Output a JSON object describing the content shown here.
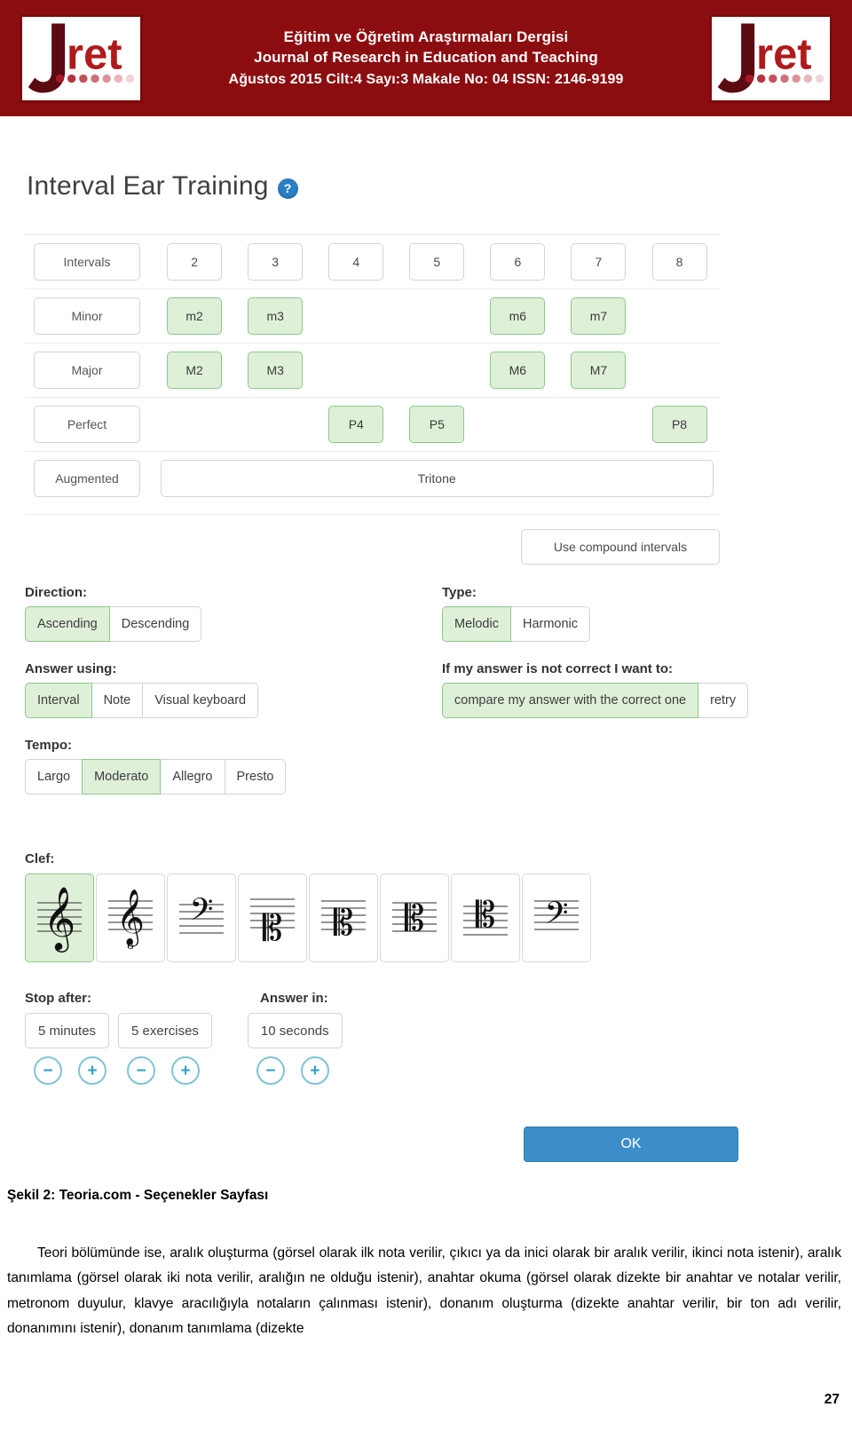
{
  "header": {
    "journal_title_tr": "Eğitim ve Öğretim Araştırmaları Dergisi",
    "journal_title_en": "Journal of Research in Education and Teaching",
    "issue_line": "Ağustos 2015  Cilt:4  Sayı:3  Makale No: 04   ISSN: 2146-9199",
    "logo_text": "ret",
    "logo_letter": "J",
    "banner_color": "#8c0d10"
  },
  "app": {
    "title": "Interval Ear Training",
    "help_icon_label": "?",
    "accent_selected_bg": "#dff0d8",
    "accent_selected_border": "#8cc88c",
    "ok_button_color": "#3d8dc9",
    "intervals_table": {
      "header_label": "Intervals",
      "columns": [
        "2",
        "3",
        "4",
        "5",
        "6",
        "7",
        "8"
      ],
      "rows": [
        {
          "label": "Minor",
          "cells": [
            {
              "text": "m2",
              "selected": true
            },
            {
              "text": "m3",
              "selected": true
            },
            {
              "text": "",
              "selected": false
            },
            {
              "text": "",
              "selected": false
            },
            {
              "text": "m6",
              "selected": true
            },
            {
              "text": "m7",
              "selected": true
            },
            {
              "text": "",
              "selected": false
            }
          ]
        },
        {
          "label": "Major",
          "cells": [
            {
              "text": "M2",
              "selected": true
            },
            {
              "text": "M3",
              "selected": true
            },
            {
              "text": "",
              "selected": false
            },
            {
              "text": "",
              "selected": false
            },
            {
              "text": "M6",
              "selected": true
            },
            {
              "text": "M7",
              "selected": true
            },
            {
              "text": "",
              "selected": false
            }
          ]
        },
        {
          "label": "Perfect",
          "cells": [
            {
              "text": "",
              "selected": false
            },
            {
              "text": "",
              "selected": false
            },
            {
              "text": "P4",
              "selected": true
            },
            {
              "text": "P5",
              "selected": true
            },
            {
              "text": "",
              "selected": false
            },
            {
              "text": "",
              "selected": false
            },
            {
              "text": "P8",
              "selected": true
            }
          ]
        }
      ],
      "augmented_label": "Augmented",
      "tritone_label": "Tritone",
      "tritone_selected": false
    },
    "compound_button": "Use compound intervals",
    "direction": {
      "label": "Direction:",
      "options": [
        {
          "text": "Ascending",
          "selected": true
        },
        {
          "text": "Descending",
          "selected": false
        }
      ]
    },
    "type": {
      "label": "Type:",
      "options": [
        {
          "text": "Melodic",
          "selected": true
        },
        {
          "text": "Harmonic",
          "selected": false
        }
      ]
    },
    "answer_using": {
      "label": "Answer using:",
      "options": [
        {
          "text": "Interval",
          "selected": true
        },
        {
          "text": "Note",
          "selected": false
        },
        {
          "text": "Visual keyboard",
          "selected": false
        }
      ]
    },
    "incorrect": {
      "label": "If my answer is not correct I want to:",
      "options": [
        {
          "text": "compare my answer with the correct one",
          "selected": true
        },
        {
          "text": "retry",
          "selected": false
        }
      ]
    },
    "tempo": {
      "label": "Tempo:",
      "options": [
        {
          "text": "Largo",
          "selected": false
        },
        {
          "text": "Moderato",
          "selected": true
        },
        {
          "text": "Allegro",
          "selected": false
        },
        {
          "text": "Presto",
          "selected": false
        }
      ]
    },
    "clef": {
      "label": "Clef:",
      "options": [
        {
          "icon": "treble-clef-icon",
          "selected": true
        },
        {
          "icon": "treble-clef-8vb-icon",
          "selected": false
        },
        {
          "icon": "bass-clef-icon",
          "selected": false
        },
        {
          "icon": "baritone-c-clef-icon",
          "selected": false
        },
        {
          "icon": "tenor-c-clef-icon",
          "selected": false
        },
        {
          "icon": "alto-c-clef-icon",
          "selected": false
        },
        {
          "icon": "mezzo-soprano-c-clef-icon",
          "selected": false
        },
        {
          "icon": "bass-clef-low-icon",
          "selected": false
        }
      ]
    },
    "stop_after": {
      "label": "Stop after:",
      "steppers": [
        {
          "value": "5 minutes",
          "minus": "−",
          "plus": "+"
        },
        {
          "value": "5 exercises",
          "minus": "−",
          "plus": "+"
        }
      ]
    },
    "answer_in": {
      "label": "Answer in:",
      "steppers": [
        {
          "value": "10 seconds",
          "minus": "−",
          "plus": "+"
        }
      ]
    },
    "ok_button": "OK"
  },
  "paper": {
    "figure_caption": "Şekil 2: Teoria.com - Seçenekler Sayfası",
    "body": "Teori bölümünde ise, aralık oluşturma (görsel olarak ilk nota verilir, çıkıcı ya da inici olarak bir aralık verilir, ikinci nota istenir), aralık tanımlama (görsel olarak iki nota verilir, aralığın ne olduğu istenir), anahtar okuma (görsel olarak dizekte bir anahtar ve notalar verilir, metronom duyulur, klavye aracılığıyla notaların çalınması istenir), donanım oluşturma (dizekte anahtar verilir, bir ton adı verilir, donanımını istenir), donanım tanımlama (dizekte",
    "page_number": "27"
  }
}
